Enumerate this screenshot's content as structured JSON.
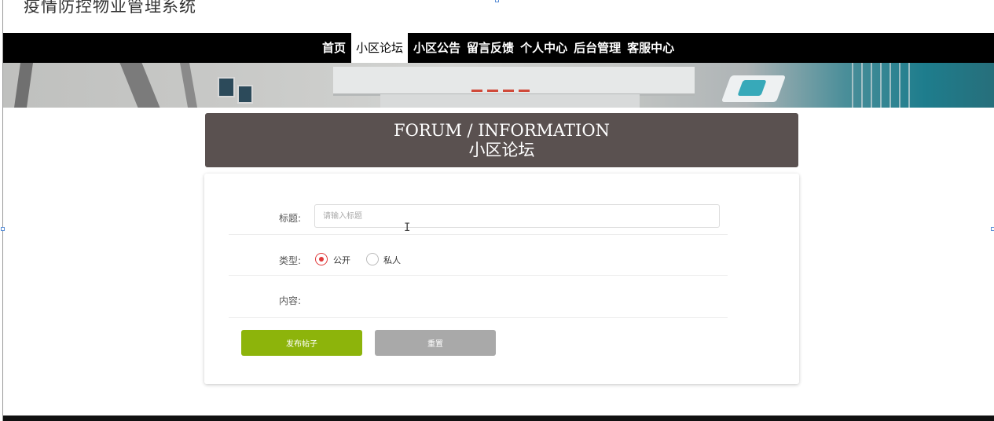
{
  "site": {
    "title": "疫情防控物业管理系统"
  },
  "nav": {
    "items": [
      {
        "label": "首页",
        "active": false
      },
      {
        "label": "小区论坛",
        "active": true
      },
      {
        "label": "小区公告",
        "active": false
      },
      {
        "label": "留言反馈",
        "active": false
      },
      {
        "label": "个人中心",
        "active": false
      },
      {
        "label": "后台管理",
        "active": false
      },
      {
        "label": "客服中心",
        "active": false
      }
    ]
  },
  "header": {
    "english": "FORUM / INFORMATION",
    "chinese": "小区论坛"
  },
  "form": {
    "title_label": "标题:",
    "title_placeholder": "请输入标题",
    "title_value": "",
    "type_label": "类型:",
    "type_options": [
      {
        "label": "公开",
        "selected": true
      },
      {
        "label": "私人",
        "selected": false
      }
    ],
    "content_label": "内容:",
    "publish_button": "发布帖子",
    "reset_button": "重置"
  },
  "colors": {
    "navbar": "#000000",
    "header_box": "#5a5150",
    "publish_button": "#8db40b",
    "reset_button": "#a9a9a9",
    "radio_selected": "#e0393a"
  }
}
